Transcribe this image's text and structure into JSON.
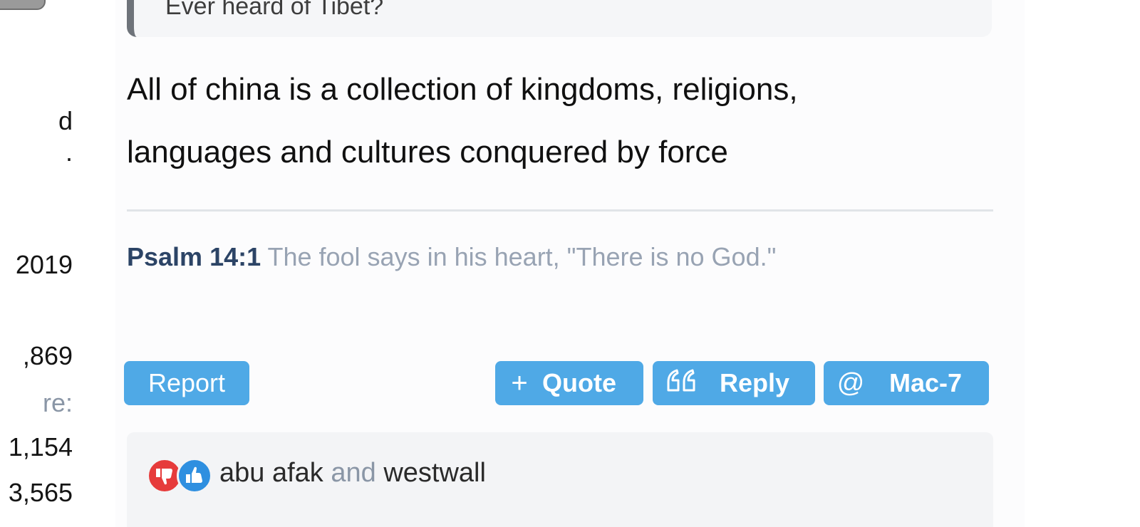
{
  "user_info": {
    "line_1": "d",
    "line_2": ".",
    "joined": "2019",
    "messages": ",869",
    "reaction_label": "re:",
    "reaction_score": "1,154",
    "points": "3,565"
  },
  "post": {
    "quoted_text": "Ever heard of Tibet?",
    "body_line_1": "All of china is a collection of kingdoms, religions,",
    "body_line_2": "languages and cultures conquered by force",
    "signature_ref": "Psalm 14:1",
    "signature_text": " The fool says in his heart, \"There is no God.\""
  },
  "actions": {
    "report_label": "Report",
    "quote_label": "Quote",
    "reply_label": "Reply",
    "mention_label": "Mac-7",
    "quote_icon": "plus-icon",
    "reply_icon": "quote-marks-icon",
    "mention_icon": "at-icon"
  },
  "reactions": {
    "user_1": "abu afak",
    "conjunction": " and ",
    "user_2": "westwall",
    "icons": [
      "thumbs-down-icon",
      "thumbs-up-icon"
    ]
  },
  "colors": {
    "button_bg": "#4fa9e6",
    "signature_ref": "#2c4466",
    "dislike": "#e63b3b",
    "like": "#2e8fe0"
  }
}
